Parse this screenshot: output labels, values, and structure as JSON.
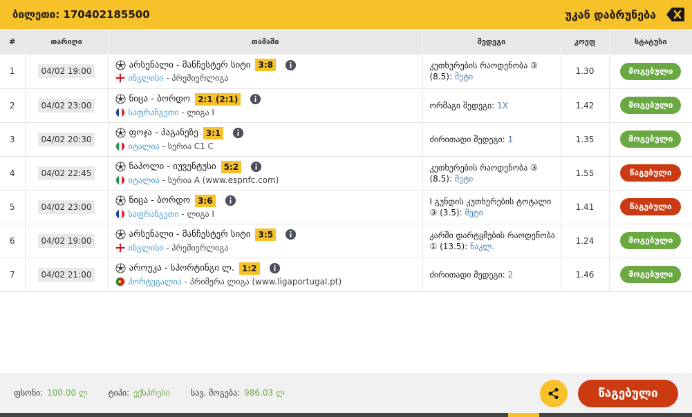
{
  "header": {
    "ticket_title": "ბილეთი: 170402185500",
    "back_label": "უკან დაბრუნება"
  },
  "columns": {
    "num": "#",
    "date": "თარიღი",
    "match": "თამაში",
    "result": "შედეგი",
    "odds": "კოეფ",
    "status": "სტატუსი"
  },
  "rows": [
    {
      "num": "1",
      "date": "04/02 19:00",
      "match": "არსენალი - მანჩესტერ სიტი",
      "score": "3:8",
      "country": "ინგლისი",
      "league": " - პრემიერლიგა",
      "flag": "england",
      "result_text": "კუთხურების რაოდენობა ③ (8.5):",
      "pick": "მეტი",
      "odds": "1.30",
      "status": "მოგებული",
      "status_type": "won"
    },
    {
      "num": "2",
      "date": "04/02 23:00",
      "match": "ნიცა - ბორდო",
      "score": "2:1 (2:1)",
      "country": "საფრანგეთი",
      "league": " - ლიგა I",
      "flag": "france",
      "result_text": "ორმაგი შედეგი:",
      "pick": "1X",
      "odds": "1.42",
      "status": "მოგებული",
      "status_type": "won"
    },
    {
      "num": "3",
      "date": "04/02 20:30",
      "match": "ფოჯა - პაგანეზე",
      "score": "3:1",
      "country": "იტალია",
      "league": " - სერია C1 C",
      "flag": "italy",
      "result_text": "ძირითადი შედეგი:",
      "pick": "1",
      "odds": "1.35",
      "status": "მოგებული",
      "status_type": "won"
    },
    {
      "num": "4",
      "date": "04/02 22:45",
      "match": "ნაპოლი - იუვენტუსი",
      "score": "5:2",
      "country": "იტალია",
      "league": " - სერია A (www.espnfc.com)",
      "flag": "italy",
      "result_text": "კუთხურების რაოდენობა ③ (8.5):",
      "pick": "მეტი",
      "odds": "1.55",
      "status": "წაგებული",
      "status_type": "lost"
    },
    {
      "num": "5",
      "date": "04/02 23:00",
      "match": "ნიცა - ბორდო",
      "score": "3:6",
      "country": "საფრანგეთი",
      "league": " - ლიგა I",
      "flag": "france",
      "result_text": "I გუნდის კუთხურების ტოტალი ③ (3.5):",
      "pick": "მეტი",
      "odds": "1.41",
      "status": "წაგებული",
      "status_type": "lost"
    },
    {
      "num": "6",
      "date": "04/02 19:00",
      "match": "არსენალი - მანჩესტერ სიტი",
      "score": "3:5",
      "country": "ინგლისი",
      "league": " - პრემიერლიგა",
      "flag": "england",
      "result_text": "კარში დარტყმების რაოდენობა ① (13.5):",
      "pick": "ნაკლ.",
      "odds": "1.24",
      "status": "მოგებული",
      "status_type": "won"
    },
    {
      "num": "7",
      "date": "04/02 21:00",
      "match": "აროუკა - სპორტინგი ლ.",
      "score": "1:2",
      "country": "პორტუგალია",
      "league": " - პრიმერა ლიგა (www.ligaportugal.pt)",
      "flag": "portugal",
      "result_text": "ძირითადი შედეგი:",
      "pick": "2",
      "odds": "1.46",
      "status": "მოგებული",
      "status_type": "won"
    }
  ],
  "footer": {
    "stake_label": "ფსონი:",
    "stake_value": "100.00 ლ",
    "type_label": "ტიპი:",
    "type_value": "ექსპრესი",
    "payout_label": "სავ. მოგება:",
    "payout_value": "986.03 ლ",
    "final_button": "წაგებული"
  },
  "colors": {
    "accent": "#f7c12a",
    "won": "#6aa842",
    "lost": "#cc3a12",
    "link": "#4a9dc6"
  }
}
